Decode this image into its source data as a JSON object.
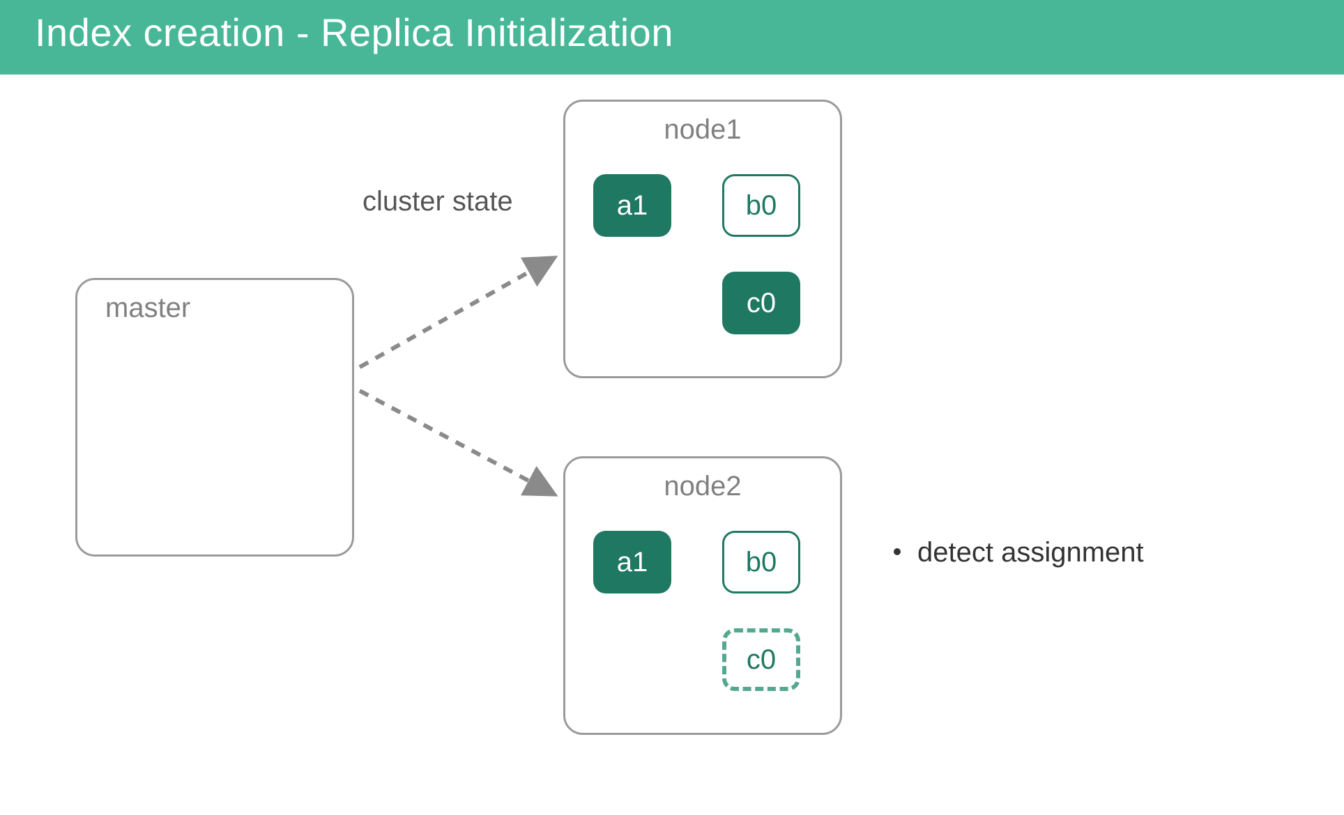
{
  "header": {
    "title": "Index creation - Replica Initialization"
  },
  "master": {
    "label": "master"
  },
  "edge": {
    "label": "cluster state"
  },
  "node1": {
    "label": "node1",
    "shards": {
      "a": "a1",
      "b": "b0",
      "c": "c0"
    }
  },
  "node2": {
    "label": "node2",
    "shards": {
      "a": "a1",
      "b": "b0",
      "c": "c0"
    }
  },
  "annotations": {
    "bullet1": "detect assignment"
  },
  "colors": {
    "header_bg": "#47b797",
    "shard_solid": "#1e7862",
    "shard_dashed_border": "#54a890",
    "box_border": "#9a9a9a"
  }
}
